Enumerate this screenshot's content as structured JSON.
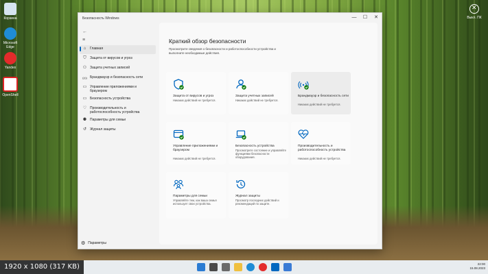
{
  "desktop": {
    "icons": [
      {
        "label": "Корзина",
        "color": "#d6e4f0"
      },
      {
        "label": "Microsoft Edge",
        "color": "#1f8cd6"
      },
      {
        "label": "Yandex",
        "color": "#e32b2b"
      },
      {
        "label": "OpenShell",
        "color": "#ffffff"
      }
    ],
    "top_right_label": "Выкл. ПК"
  },
  "window": {
    "title": "Безопасность Windows",
    "controls": [
      "—",
      "☐",
      "✕"
    ]
  },
  "sidebar": {
    "items": [
      {
        "icon": "home-icon",
        "glyph": "⌂",
        "label": "Главная",
        "active": true
      },
      {
        "icon": "shield-icon",
        "glyph": "⛉",
        "label": "Защита от вирусов и угроз"
      },
      {
        "icon": "person-icon",
        "glyph": "⚇",
        "label": "Защита учетных записей"
      },
      {
        "icon": "wifi-icon",
        "glyph": "((•))",
        "label": "Брандмауэр и безопасность сети"
      },
      {
        "icon": "app-browser-icon",
        "glyph": "▭",
        "label": "Управление приложениями и браузером"
      },
      {
        "icon": "laptop-icon",
        "glyph": "▭",
        "label": "Безопасность устройства"
      },
      {
        "icon": "heart-pulse-icon",
        "glyph": "♡",
        "label": "Производительность и работоспособность устройства"
      },
      {
        "icon": "family-icon",
        "glyph": "⚉",
        "label": "Параметры для семьи"
      },
      {
        "icon": "history-icon",
        "glyph": "↺",
        "label": "Журнал защиты"
      }
    ],
    "settings_label": "Параметры"
  },
  "main": {
    "title": "Краткий обзор безопасности",
    "description": "Просмотрите сведения о безопасности и работоспособности устройства и выполните необходимые действия."
  },
  "cards": [
    {
      "title": "Защита от вирусов и угроз",
      "status": "Никаких действий не требуется.",
      "icon": "shield-icon",
      "ok": true
    },
    {
      "title": "Защита учетных записей",
      "status": "Никаких действий не требуется.",
      "icon": "person-icon",
      "ok": true
    },
    {
      "title": "Брандмауэр и безопасность сети",
      "status": "Никаких действий не требуется.",
      "icon": "wifi-icon",
      "ok": true
    },
    {
      "title": "Управление приложениями и браузером",
      "status": "Никаких действий не требуется.",
      "icon": "app-browser-icon",
      "ok": true
    },
    {
      "title": "Безопасность устройства",
      "status": "Просмотрите состояние и управляйте функциями безопасности оборудования.",
      "icon": "laptop-icon",
      "ok": true
    },
    {
      "title": "Производительность и работоспособность устройства",
      "status": "Никаких действий не требуется.",
      "icon": "heart-pulse-icon",
      "ok": false
    },
    {
      "title": "Параметры для семьи",
      "status": "Управляйте тем, как ваша семья использует свои устройства.",
      "icon": "family-icon",
      "ok": false
    },
    {
      "title": "Журнал защиты",
      "status": "Просмотр последних действий и рекомендаций по защите.",
      "icon": "history-icon",
      "ok": false
    }
  ],
  "taskbar": {
    "time": "22:00",
    "date": "15.08.2023"
  },
  "overlay": {
    "label": "1920 x 1080 (317 KB)"
  },
  "colors": {
    "accent": "#0067c0",
    "ok": "#107c10"
  }
}
